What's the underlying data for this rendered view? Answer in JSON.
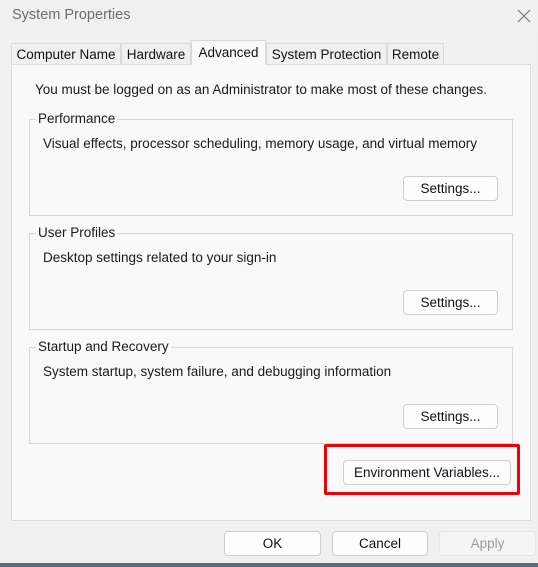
{
  "window": {
    "title": "System Properties",
    "close_icon": "close-icon"
  },
  "tabs": [
    {
      "label": "Computer Name",
      "active": false
    },
    {
      "label": "Hardware",
      "active": false
    },
    {
      "label": "Advanced",
      "active": true
    },
    {
      "label": "System Protection",
      "active": false
    },
    {
      "label": "Remote",
      "active": false
    }
  ],
  "advanced": {
    "notice": "You must be logged on as an Administrator to make most of these changes.",
    "groups": [
      {
        "title": "Performance",
        "description": "Visual effects, processor scheduling, memory usage, and virtual memory",
        "button": "Settings..."
      },
      {
        "title": "User Profiles",
        "description": "Desktop settings related to your sign-in",
        "button": "Settings..."
      },
      {
        "title": "Startup and Recovery",
        "description": "System startup, system failure, and debugging information",
        "button": "Settings..."
      }
    ],
    "env_button": "Environment Variables...",
    "highlight_color": "#f00000"
  },
  "footer": {
    "ok": "OK",
    "cancel": "Cancel",
    "apply": "Apply",
    "apply_enabled": false
  }
}
